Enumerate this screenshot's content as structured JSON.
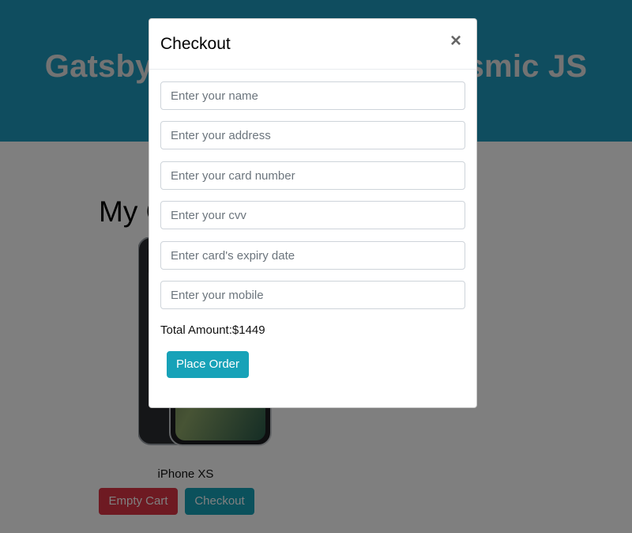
{
  "page": {
    "hero_title": "Gatsby Ecommerce with Cosmic JS",
    "cart_heading": "My Cart",
    "product_name": "iPhone XS",
    "empty_cart_label": "Empty Cart",
    "checkout_label": "Checkout"
  },
  "modal": {
    "title": "Checkout",
    "close_glyph": "×",
    "fields": {
      "name_placeholder": "Enter your name",
      "address_placeholder": "Enter your address",
      "card_placeholder": "Enter your card number",
      "cvv_placeholder": "Enter your cvv",
      "expiry_placeholder": "Enter card's expiry date",
      "mobile_placeholder": "Enter your mobile"
    },
    "total_label": "Total Amount:",
    "total_value": "$1449",
    "place_order_label": "Place Order"
  },
  "colors": {
    "hero_bg": "#1f9bbf",
    "danger": "#dc3545",
    "info": "#17a2b8"
  },
  "icons": {
    "close": "close-icon"
  }
}
